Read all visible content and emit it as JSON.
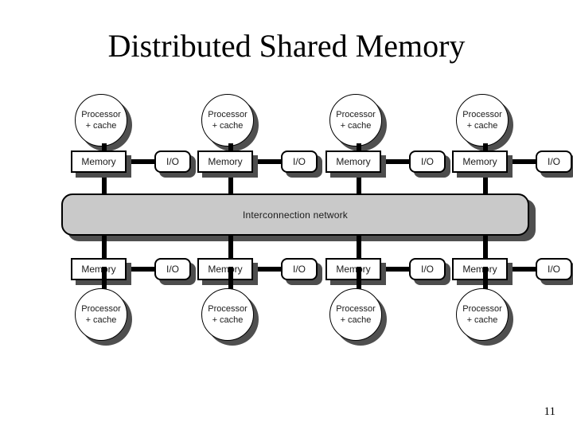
{
  "slide": {
    "title": "Distributed Shared Memory",
    "page_number": "11",
    "background_color": "#ffffff"
  },
  "diagram": {
    "type": "architecture-diagram",
    "network": {
      "label": "Interconnection network",
      "fill_color": "#c9c9c9",
      "shadow_color": "#4f4f4f",
      "border_color": "#000000"
    },
    "node_labels": {
      "processor_line1": "Processor",
      "processor_line2": "+ cache",
      "memory": "Memory",
      "io": "I/O"
    },
    "top_nodes": [
      {
        "processor_line1": "Processor",
        "processor_line2": "+ cache",
        "memory": "Memory",
        "io": "I/O"
      },
      {
        "processor_line1": "Processor",
        "processor_line2": "+ cache",
        "memory": "Memory",
        "io": "I/O"
      },
      {
        "processor_line1": "Processor",
        "processor_line2": "+ cache",
        "memory": "Memory",
        "io": "I/O"
      },
      {
        "processor_line1": "Processor",
        "processor_line2": "+ cache",
        "memory": "Memory",
        "io": "I/O"
      }
    ],
    "bottom_nodes": [
      {
        "processor_line1": "Processor",
        "processor_line2": "+ cache",
        "memory": "Memory",
        "io": "I/O"
      },
      {
        "processor_line1": "Processor",
        "processor_line2": "+ cache",
        "memory": "Memory",
        "io": "I/O"
      },
      {
        "processor_line1": "Processor",
        "processor_line2": "+ cache",
        "memory": "Memory",
        "io": "I/O"
      },
      {
        "processor_line1": "Processor",
        "processor_line2": "+ cache",
        "memory": "Memory",
        "io": "I/O"
      }
    ]
  }
}
